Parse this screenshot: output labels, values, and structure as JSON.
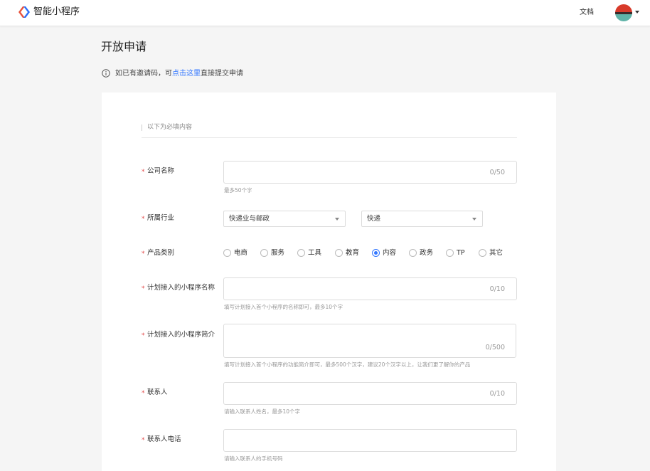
{
  "header": {
    "app_name": "智能小程序",
    "doc_link": "文档",
    "colors": {
      "logo_blue": "#2d6ef7",
      "logo_red": "#e8503a"
    }
  },
  "page": {
    "title": "开放申请",
    "info_prefix": "如已有邀请码，可",
    "info_link": "点击这里",
    "info_suffix": "直接提交申请"
  },
  "form": {
    "section_title": "以下为必填内容",
    "required_mark": "*",
    "company_name": {
      "label": "公司名称",
      "counter": "0/50",
      "hint": "最多50个字"
    },
    "industry": {
      "label": "所属行业",
      "primary": "快递业与邮政",
      "secondary": "快递"
    },
    "product_type": {
      "label": "产品类别",
      "options": [
        "电商",
        "服务",
        "工具",
        "教育",
        "内容",
        "政务",
        "TP",
        "其它"
      ],
      "selected": "内容"
    },
    "mini_program_name": {
      "label": "计划接入的小程序名称",
      "counter": "0/10",
      "hint": "填写计划接入首个小程序的名称即可，最多10个字"
    },
    "mini_program_intro": {
      "label": "计划接入的小程序简介",
      "counter": "0/500",
      "hint": "填写计划接入首个小程序的功能简介即可，最多500个汉字，建议20个汉字以上，让我们更了解你的产品"
    },
    "contact": {
      "label": "联系人",
      "counter": "0/10",
      "hint": "请输入联系人姓名，最多10个字"
    },
    "contact_phone": {
      "label": "联系人电话",
      "hint": "请输入联系人的手机号码"
    }
  }
}
